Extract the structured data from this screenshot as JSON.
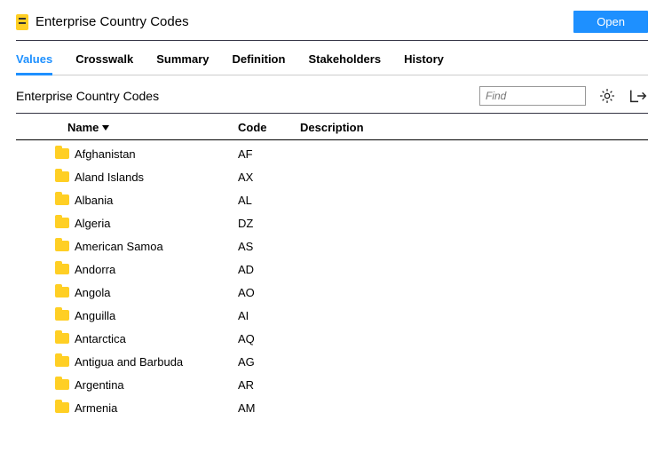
{
  "header": {
    "title": "Enterprise Country Codes",
    "open_label": "Open"
  },
  "tabs": [
    {
      "label": "Values",
      "active": true
    },
    {
      "label": "Crosswalk",
      "active": false
    },
    {
      "label": "Summary",
      "active": false
    },
    {
      "label": "Definition",
      "active": false
    },
    {
      "label": "Stakeholders",
      "active": false
    },
    {
      "label": "History",
      "active": false
    }
  ],
  "toolbar": {
    "breadcrumb": "Enterprise Country Codes",
    "find_placeholder": "Find"
  },
  "columns": {
    "name": "Name",
    "code": "Code",
    "description": "Description"
  },
  "rows": [
    {
      "name": "Afghanistan",
      "code": "AF",
      "description": ""
    },
    {
      "name": "Aland Islands",
      "code": "AX",
      "description": ""
    },
    {
      "name": "Albania",
      "code": "AL",
      "description": ""
    },
    {
      "name": "Algeria",
      "code": "DZ",
      "description": ""
    },
    {
      "name": "American Samoa",
      "code": "AS",
      "description": ""
    },
    {
      "name": "Andorra",
      "code": "AD",
      "description": ""
    },
    {
      "name": "Angola",
      "code": "AO",
      "description": ""
    },
    {
      "name": "Anguilla",
      "code": "AI",
      "description": ""
    },
    {
      "name": "Antarctica",
      "code": "AQ",
      "description": ""
    },
    {
      "name": "Antigua and Barbuda",
      "code": "AG",
      "description": ""
    },
    {
      "name": "Argentina",
      "code": "AR",
      "description": ""
    },
    {
      "name": "Armenia",
      "code": "AM",
      "description": ""
    }
  ]
}
